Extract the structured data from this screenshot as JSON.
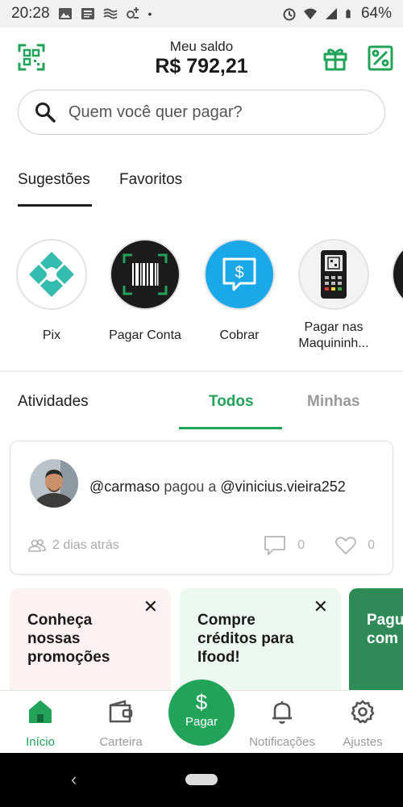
{
  "status_bar": {
    "time": "20:28",
    "battery": "64%"
  },
  "header": {
    "balance_label": "Meu saldo",
    "balance_value": "R$ 792,21"
  },
  "search": {
    "placeholder": "Quem você quer pagar?"
  },
  "tabs": {
    "suggestions": "Sugestões",
    "favorites": "Favoritos"
  },
  "shortcuts": {
    "pix": "Pix",
    "pay_bill": "Pagar Conta",
    "charge": "Cobrar",
    "pay_machines": "Pagar nas Maquininh..."
  },
  "activities": {
    "title": "Atividades",
    "tab_all": "Todos",
    "tab_mine": "Minhas",
    "card": {
      "payer": "@carmaso",
      "verb": "pagou a",
      "payee": "@vinicius.vieira252",
      "time": "2 dias atrás",
      "comments": "0",
      "likes": "0"
    }
  },
  "promos": {
    "promo1": "Conheça nossas promoções",
    "promo2": "Compre créditos para Ifood!",
    "promo3": "Pagu com c"
  },
  "bottom_nav": {
    "home": "Início",
    "wallet": "Carteira",
    "pay": "Pagar",
    "pay_symbol": "$",
    "notifications": "Notificações",
    "settings": "Ajustes"
  },
  "colors": {
    "brand_green": "#21a35a",
    "pix_teal": "#32bcad",
    "charge_blue": "#1ba8e8"
  }
}
